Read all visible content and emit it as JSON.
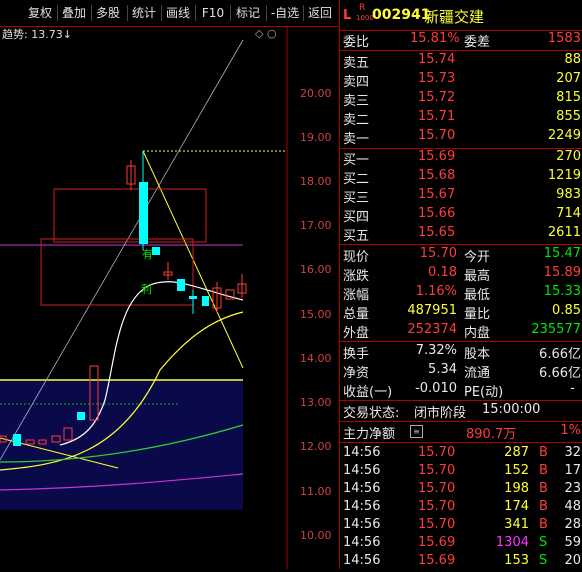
{
  "toolbar": {
    "items": [
      "复权",
      "叠加",
      "多股",
      "统计",
      "画线",
      "F10",
      "标记",
      "-自选",
      "返回"
    ]
  },
  "chart": {
    "trend_label": "趋势:",
    "trend_value": "13.73↓",
    "price_ticks": [
      "20.00",
      "19.00",
      "18.00",
      "17.00",
      "16.00",
      "15.00",
      "14.00",
      "13.00",
      "12.00",
      "11.00",
      "10.00"
    ],
    "annotations": [
      "有",
      "利"
    ]
  },
  "stock": {
    "market_badge": "L",
    "r_badge": "R",
    "sub_badge": "1000",
    "code": "002941",
    "name": "新疆交建"
  },
  "ratio": {
    "label": "委比",
    "value": "15.81%",
    "diff_label": "委差",
    "diff": "1583"
  },
  "asks": [
    {
      "label": "卖五",
      "price": "15.74",
      "vol": "88"
    },
    {
      "label": "卖四",
      "price": "15.73",
      "vol": "207"
    },
    {
      "label": "卖三",
      "price": "15.72",
      "vol": "815"
    },
    {
      "label": "卖二",
      "price": "15.71",
      "vol": "855"
    },
    {
      "label": "卖一",
      "price": "15.70",
      "vol": "2249"
    }
  ],
  "bids": [
    {
      "label": "买一",
      "price": "15.69",
      "vol": "270"
    },
    {
      "label": "买二",
      "price": "15.68",
      "vol": "1219"
    },
    {
      "label": "买三",
      "price": "15.67",
      "vol": "983"
    },
    {
      "label": "买四",
      "price": "15.66",
      "vol": "714"
    },
    {
      "label": "买五",
      "price": "15.65",
      "vol": "2611"
    }
  ],
  "quote": [
    {
      "l1": "现价",
      "v1": "15.70",
      "l2": "今开",
      "v2": "15.47"
    },
    {
      "l1": "涨跌",
      "v1": "0.18",
      "l2": "最高",
      "v2": "15.89"
    },
    {
      "l1": "涨幅",
      "v1": "1.16%",
      "l2": "最低",
      "v2": "15.33"
    },
    {
      "l1": "总量",
      "v1": "487951",
      "l2": "量比",
      "v2": "0.85"
    },
    {
      "l1": "外盘",
      "v1": "252374",
      "l2": "内盘",
      "v2": "235577"
    }
  ],
  "fundamentals": [
    {
      "l1": "换手",
      "v1": "7.32%",
      "l2": "股本",
      "v2": "6.66亿"
    },
    {
      "l1": "净资",
      "v1": "5.34",
      "l2": "流通",
      "v2": "6.66亿"
    },
    {
      "l1": "收益(一)",
      "v1": "-0.010",
      "l2": "PE(动)",
      "v2": "-"
    }
  ],
  "status": {
    "label": "交易状态:",
    "phase": "闭市阶段",
    "time": "15:00:00"
  },
  "capital": {
    "label": "主力净额",
    "value": "890.7万",
    "pct": "1%"
  },
  "ticks": [
    {
      "time": "14:56",
      "price": "15.70",
      "vol": "287",
      "side": "B",
      "n": "32"
    },
    {
      "time": "14:56",
      "price": "15.70",
      "vol": "152",
      "side": "B",
      "n": "17"
    },
    {
      "time": "14:56",
      "price": "15.70",
      "vol": "198",
      "side": "B",
      "n": "23"
    },
    {
      "time": "14:56",
      "price": "15.70",
      "vol": "174",
      "side": "B",
      "n": "48"
    },
    {
      "time": "14:56",
      "price": "15.70",
      "vol": "341",
      "side": "B",
      "n": "28"
    },
    {
      "time": "14:56",
      "price": "15.69",
      "vol": "1304",
      "side": "S",
      "n": "59"
    },
    {
      "time": "14:56",
      "price": "15.69",
      "vol": "153",
      "side": "S",
      "n": "20"
    }
  ],
  "colors": {
    "up": "#ff3b3b",
    "down": "#00ffff",
    "border": "#b00000",
    "text_green": "#00e600",
    "text_yellow": "#ffff33"
  }
}
